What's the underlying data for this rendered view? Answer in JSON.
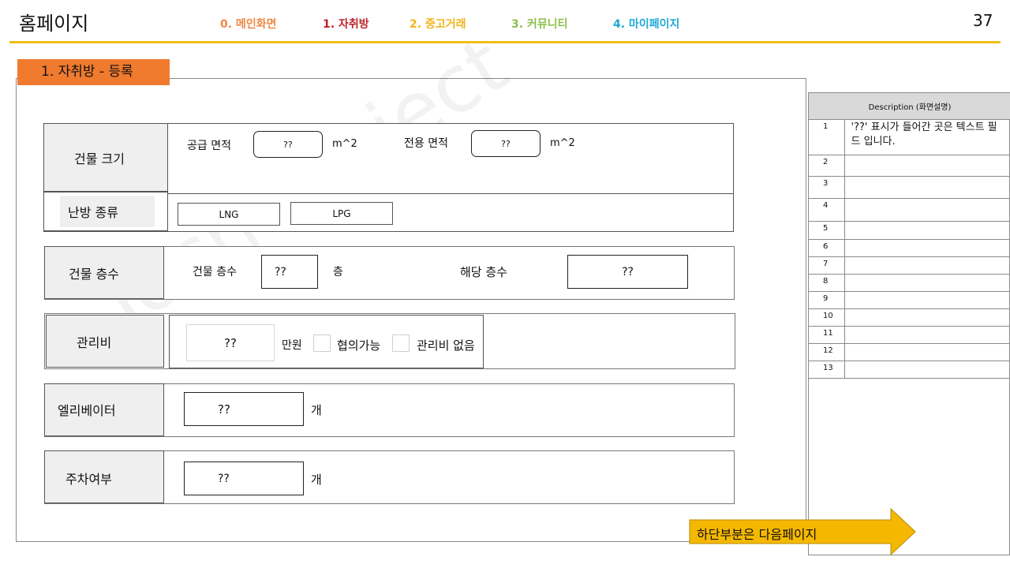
{
  "header": {
    "title": "홈페이지",
    "page_number": "37",
    "nav": [
      {
        "label": "0. 메인화면",
        "color": "#ee8844"
      },
      {
        "label": "1. 자취방",
        "color": "#c0242b"
      },
      {
        "label": "2. 중고거래",
        "color": "#f2b418"
      },
      {
        "label": "3. 커뮤니티",
        "color": "#8cc04b"
      },
      {
        "label": "4. 마이페이지",
        "color": "#1fa8d6"
      }
    ],
    "accent_color": "#f2bd1a"
  },
  "section_tab": {
    "label": "1. 자취방 - 등록",
    "color": "#f07a2e"
  },
  "form": {
    "building_size": {
      "label": "건물 크기",
      "supply_area_label": "공급 면적",
      "supply_area_value": "??",
      "unit1": "m^2",
      "exclusive_area_label": "전용 면적",
      "exclusive_area_value": "??",
      "unit2": "m^2"
    },
    "heating": {
      "label": "난방 종류",
      "option1": "LNG",
      "option2": "LPG"
    },
    "floors": {
      "label": "건물 층수",
      "building_floors_label": "건물 층수",
      "building_floors_value": "??",
      "floor_unit": "층",
      "current_floor_label": "해당 층수",
      "current_floor_value": "??"
    },
    "maintenance": {
      "label": "관리비",
      "value": "??",
      "unit": "만원",
      "negotiable_label": "협의가능",
      "none_label": "관리비 없음"
    },
    "elevator": {
      "label": "엘리베이터",
      "value": "??",
      "unit": "개"
    },
    "parking": {
      "label": "주차여부",
      "value": "??",
      "unit": "개"
    }
  },
  "description": {
    "header": "Description (화면설명)",
    "rows": [
      {
        "num": "1",
        "text": "'??' 표시가 들어간 곳은 텍스트 필드 입니다."
      },
      {
        "num": "2",
        "text": ""
      },
      {
        "num": "3",
        "text": ""
      },
      {
        "num": "4",
        "text": ""
      },
      {
        "num": "5",
        "text": ""
      },
      {
        "num": "6",
        "text": ""
      },
      {
        "num": "7",
        "text": ""
      },
      {
        "num": "8",
        "text": ""
      },
      {
        "num": "9",
        "text": ""
      },
      {
        "num": "10",
        "text": ""
      },
      {
        "num": "11",
        "text": ""
      },
      {
        "num": "12",
        "text": ""
      },
      {
        "num": "13",
        "text": ""
      }
    ]
  },
  "watermark": "Toch Project",
  "next_page_note": {
    "label": "하단부분은 다음페이지",
    "color": "#f5b800"
  }
}
